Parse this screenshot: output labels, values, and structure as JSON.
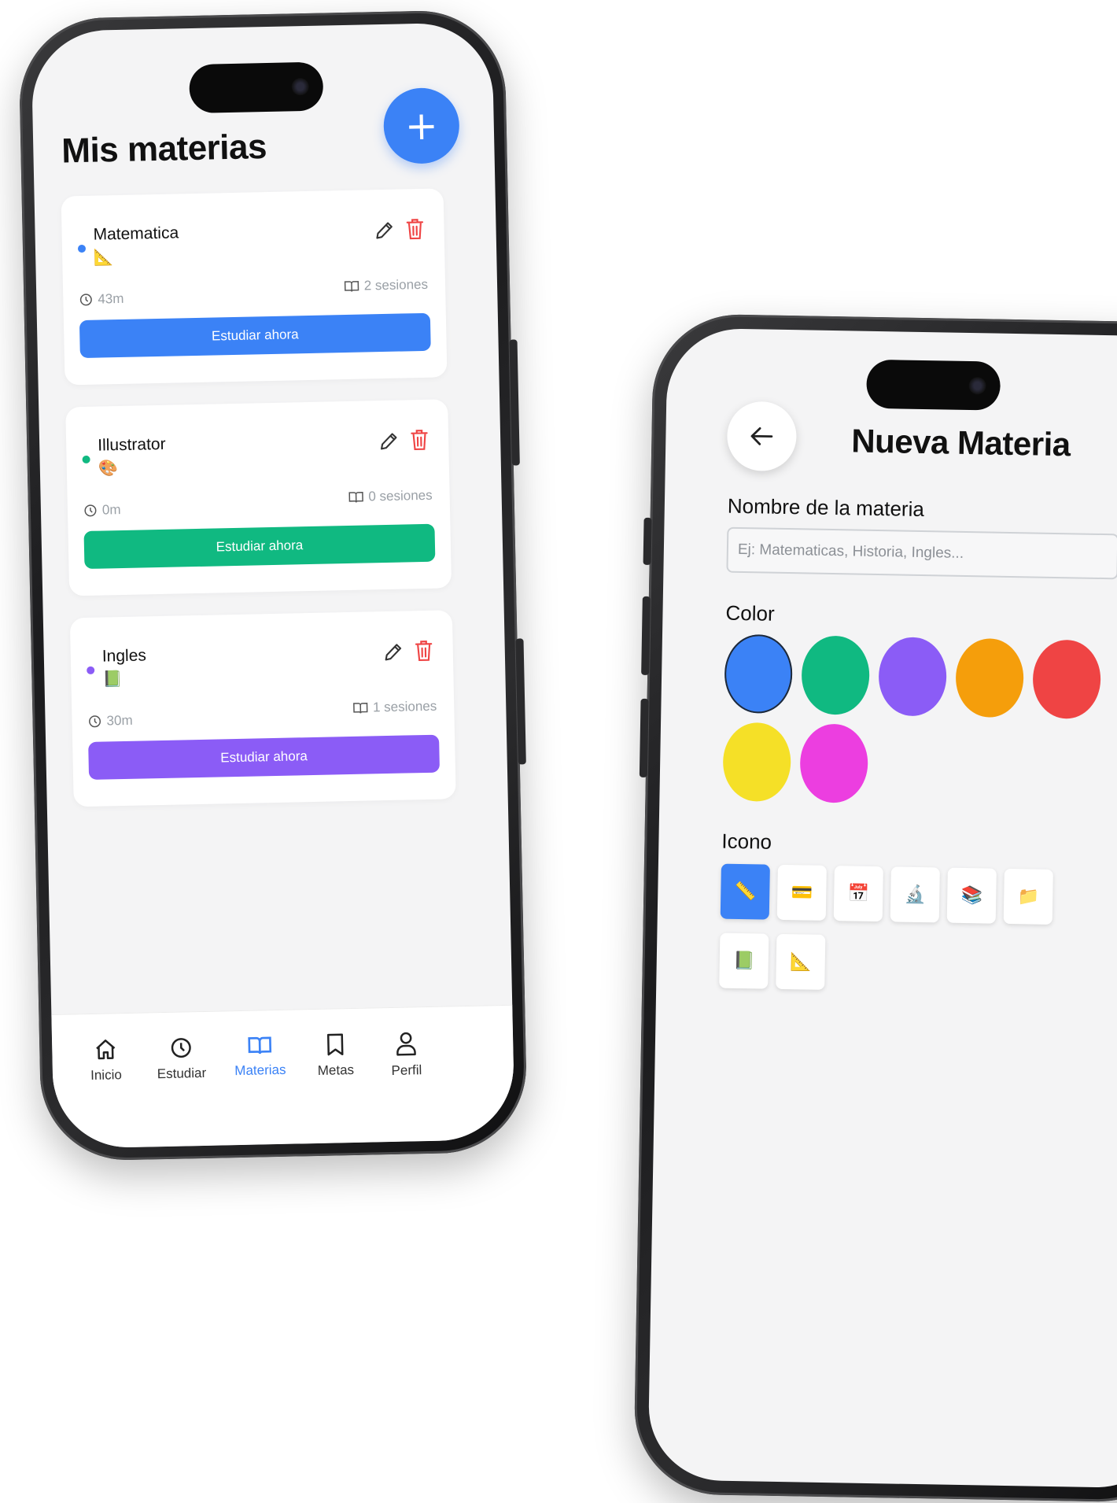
{
  "list_screen": {
    "title": "Mis materias",
    "add_label": "+",
    "subjects": [
      {
        "name": "Matematica",
        "icon": "📐",
        "dot_color": "#3b82f6",
        "time": "43m",
        "sessions": "2 sesiones",
        "button_label": "Estudiar ahora",
        "button_color": "#3b82f6"
      },
      {
        "name": "Illustrator",
        "icon": "🎨",
        "dot_color": "#10b981",
        "time": "0m",
        "sessions": "0 sesiones",
        "button_label": "Estudiar ahora",
        "button_color": "#10b981"
      },
      {
        "name": "Ingles",
        "icon": "📗",
        "dot_color": "#8b5cf6",
        "time": "30m",
        "sessions": "1 sesiones",
        "button_label": "Estudiar ahora",
        "button_color": "#8b5cf6"
      }
    ],
    "tabs": [
      {
        "label": "Inicio",
        "icon": "home-icon"
      },
      {
        "label": "Estudiar",
        "icon": "clock-icon"
      },
      {
        "label": "Materias",
        "icon": "book-icon",
        "active": true
      },
      {
        "label": "Metas",
        "icon": "bookmark-icon"
      },
      {
        "label": "Perfil",
        "icon": "user-icon"
      }
    ],
    "active_color": "#3b82f6"
  },
  "form_screen": {
    "title": "Nueva Materia",
    "name_label": "Nombre de la materia",
    "name_placeholder": "Ej: Matematicas, Historia, Ingles...",
    "name_value": "",
    "color_label": "Color",
    "colors": [
      "#3b82f6",
      "#10b981",
      "#8b5cf6",
      "#f59e0b",
      "#ef4444",
      "#f5e027",
      "#ec3ee0"
    ],
    "selected_color": "#3b82f6",
    "icon_label": "Icono",
    "icons": [
      "📏",
      "💳",
      "📅",
      "🔬",
      "📚",
      "📁",
      "📗",
      "📐"
    ],
    "selected_icon": "📏"
  }
}
